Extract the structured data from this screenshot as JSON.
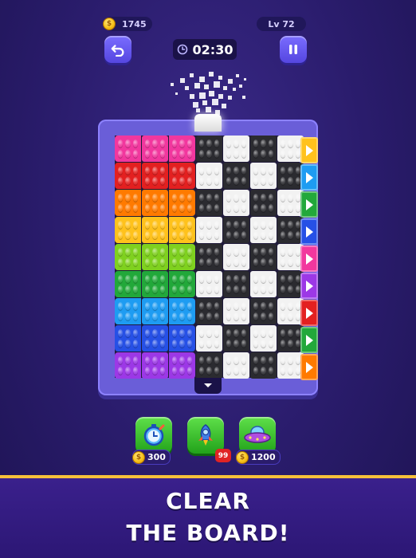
{
  "hud": {
    "coins": "1745",
    "level": "Lv 72",
    "timer": "02:30",
    "undo_icon": "undo-arrow-icon",
    "pause_icon": "pause-icon"
  },
  "board": {
    "colors": {
      "pink": "#f2379e",
      "red": "#e32020",
      "orange": "#ff7a00",
      "yellow": "#ffc21c",
      "lime": "#7fd11f",
      "green": "#22a83a",
      "skyblue": "#1e9cf2",
      "blue": "#2650e6",
      "purple": "#9c38e6",
      "black": "#2b2b30",
      "white": "#f2f2f2"
    },
    "rows": [
      {
        "color": "pink",
        "arrow": "yellow"
      },
      {
        "color": "red",
        "arrow": "skyblue"
      },
      {
        "color": "orange",
        "arrow": "green"
      },
      {
        "color": "yellow",
        "arrow": "blue"
      },
      {
        "color": "lime",
        "arrow": "pink"
      },
      {
        "color": "green",
        "arrow": "purple"
      },
      {
        "color": "skyblue",
        "arrow": "red"
      },
      {
        "color": "blue",
        "arrow": "green"
      },
      {
        "color": "purple",
        "arrow": "orange"
      }
    ]
  },
  "boosters": [
    {
      "name": "time-freeze-booster",
      "icon": "clock-icon",
      "price": "300",
      "coin": true
    },
    {
      "name": "rocket-booster",
      "icon": "rocket-icon",
      "badge": "99",
      "coin": false
    },
    {
      "name": "ufo-booster",
      "icon": "ufo-icon",
      "price": "1200",
      "coin": true
    }
  ],
  "banner": {
    "line1": "CLEAR",
    "line2": "THE BOARD!"
  }
}
